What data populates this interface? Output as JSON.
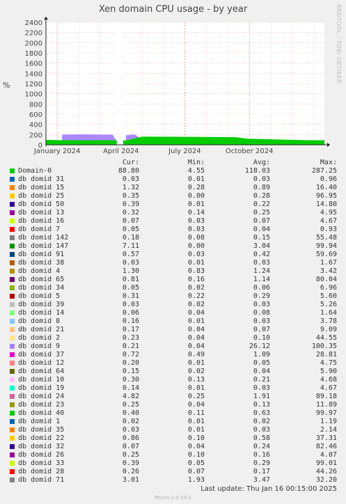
{
  "chart_data": {
    "type": "area",
    "title": "Xen domain CPU usage - by year",
    "ylabel": "%",
    "ylim": [
      0,
      2400
    ],
    "yticks": [
      0,
      200,
      400,
      600,
      800,
      1000,
      1200,
      1400,
      1600,
      1800,
      2000,
      2200,
      2400
    ],
    "xticks": [
      "January 2024",
      "April 2024",
      "July 2024",
      "October 2024"
    ],
    "x_range": [
      "2023-12-16",
      "2025-01-16"
    ],
    "grid": true,
    "series_approx": [
      {
        "name": "Domain-0",
        "color": "#00cc00",
        "points": [
          [
            "2023-12-16",
            95
          ],
          [
            "2024-01-08",
            90
          ],
          [
            "2024-03-25",
            88
          ],
          [
            "2024-04-08",
            85
          ],
          [
            "2024-05-01",
            160
          ],
          [
            "2024-09-10",
            150
          ],
          [
            "2024-09-28",
            120
          ],
          [
            "2024-12-20",
            90
          ],
          [
            "2025-01-16",
            88
          ]
        ]
      },
      {
        "name": "db domid 9",
        "color": "#aa88ff",
        "points": [
          [
            "2024-01-08",
            110
          ],
          [
            "2024-02-01",
            115
          ],
          [
            "2024-03-20",
            110
          ],
          [
            "2024-03-25",
            0
          ]
        ]
      },
      {
        "name": "db domid 9",
        "color": "#aa88ff",
        "points": [
          [
            "2024-04-08",
            100
          ],
          [
            "2024-04-20",
            80
          ],
          [
            "2024-04-27",
            0
          ]
        ]
      }
    ],
    "columns": [
      "Cur:",
      "Min:",
      "Avg:",
      "Max:"
    ],
    "legend": [
      {
        "name": "Domain-0",
        "color": "#00cc00",
        "cur": "88.80",
        "min": "4.55",
        "avg": "118.03",
        "max": "287.25"
      },
      {
        "name": "db domid 31",
        "color": "#0066b3",
        "cur": "0.03",
        "min": "0.01",
        "avg": "0.03",
        "max": "0.96"
      },
      {
        "name": "db domid 15",
        "color": "#ff8000",
        "cur": "1.32",
        "min": "0.28",
        "avg": "0.89",
        "max": "16.40"
      },
      {
        "name": "db domid 25",
        "color": "#ffcc00",
        "cur": "0.35",
        "min": "0.00",
        "avg": "0.28",
        "max": "96.95"
      },
      {
        "name": "db domid 50",
        "color": "#330099",
        "cur": "0.39",
        "min": "0.01",
        "avg": "0.22",
        "max": "14.80"
      },
      {
        "name": "db domid 13",
        "color": "#990099",
        "cur": "0.32",
        "min": "0.14",
        "avg": "0.25",
        "max": "4.95"
      },
      {
        "name": "db domid 16",
        "color": "#ccff00",
        "cur": "0.07",
        "min": "0.03",
        "avg": "0.07",
        "max": "4.67"
      },
      {
        "name": "db domid 7",
        "color": "#ff0000",
        "cur": "0.05",
        "min": "0.03",
        "avg": "0.04",
        "max": "0.93"
      },
      {
        "name": "db domid 142",
        "color": "#808080",
        "cur": "0.18",
        "min": "0.08",
        "avg": "0.15",
        "max": "55.48"
      },
      {
        "name": "db domid 147",
        "color": "#008f00",
        "cur": "7.11",
        "min": "0.00",
        "avg": "3.04",
        "max": "99.94"
      },
      {
        "name": "db domid 91",
        "color": "#00487d",
        "cur": "0.57",
        "min": "0.03",
        "avg": "0.42",
        "max": "59.69"
      },
      {
        "name": "db domid 38",
        "color": "#b35a00",
        "cur": "0.03",
        "min": "0.01",
        "avg": "0.03",
        "max": "1.67"
      },
      {
        "name": "db domid 4",
        "color": "#b38f00",
        "cur": "1.30",
        "min": "0.83",
        "avg": "1.24",
        "max": "3.42"
      },
      {
        "name": "db domid 65",
        "color": "#6b006b",
        "cur": "0.81",
        "min": "0.16",
        "avg": "1.14",
        "max": "80.04"
      },
      {
        "name": "db domid 34",
        "color": "#8fb300",
        "cur": "0.05",
        "min": "0.02",
        "avg": "0.06",
        "max": "6.96"
      },
      {
        "name": "db domid 5",
        "color": "#b30000",
        "cur": "0.31",
        "min": "0.22",
        "avg": "0.29",
        "max": "5.60"
      },
      {
        "name": "db domid 39",
        "color": "#bebebe",
        "cur": "0.03",
        "min": "0.02",
        "avg": "0.03",
        "max": "5.26"
      },
      {
        "name": "db domid 14",
        "color": "#80ff80",
        "cur": "0.06",
        "min": "0.04",
        "avg": "0.08",
        "max": "1.64"
      },
      {
        "name": "db domid 8",
        "color": "#80c9ff",
        "cur": "0.16",
        "min": "0.01",
        "avg": "0.03",
        "max": "3.78"
      },
      {
        "name": "db domid 21",
        "color": "#ffc080",
        "cur": "0.17",
        "min": "0.04",
        "avg": "0.07",
        "max": "9.09"
      },
      {
        "name": "db domid 2",
        "color": "#ffe680",
        "cur": "0.23",
        "min": "0.04",
        "avg": "0.10",
        "max": "44.55"
      },
      {
        "name": "db domid 9",
        "color": "#aa80ff",
        "cur": "0.21",
        "min": "0.04",
        "avg": "26.12",
        "max": "100.35"
      },
      {
        "name": "db domid 37",
        "color": "#ee00cc",
        "cur": "0.72",
        "min": "0.49",
        "avg": "1.09",
        "max": "28.81"
      },
      {
        "name": "db domid 12",
        "color": "#ff8080",
        "cur": "0.20",
        "min": "0.01",
        "avg": "0.05",
        "max": "4.75"
      },
      {
        "name": "db domid 64",
        "color": "#666600",
        "cur": "0.15",
        "min": "0.02",
        "avg": "0.04",
        "max": "5.90"
      },
      {
        "name": "db domid 10",
        "color": "#ffbfff",
        "cur": "0.30",
        "min": "0.13",
        "avg": "0.21",
        "max": "4.68"
      },
      {
        "name": "db domid 19",
        "color": "#00ffcc",
        "cur": "0.14",
        "min": "0.01",
        "avg": "0.03",
        "max": "4.67"
      },
      {
        "name": "db domid 24",
        "color": "#cc6699",
        "cur": "4.82",
        "min": "0.25",
        "avg": "1.91",
        "max": "89.18"
      },
      {
        "name": "db domid 23",
        "color": "#999900",
        "cur": "0.25",
        "min": "0.04",
        "avg": "0.13",
        "max": "11.89"
      },
      {
        "name": "db domid 40",
        "color": "#00cc00",
        "cur": "0.40",
        "min": "0.11",
        "avg": "0.63",
        "max": "99.97"
      },
      {
        "name": "db domid 1",
        "color": "#0066b3",
        "cur": "0.02",
        "min": "0.01",
        "avg": "0.02",
        "max": "1.19"
      },
      {
        "name": "db domid 35",
        "color": "#ff8000",
        "cur": "0.03",
        "min": "0.01",
        "avg": "0.03",
        "max": "2.14"
      },
      {
        "name": "db domid 22",
        "color": "#ffcc00",
        "cur": "0.86",
        "min": "0.10",
        "avg": "0.58",
        "max": "37.31"
      },
      {
        "name": "db domid 32",
        "color": "#330099",
        "cur": "0.07",
        "min": "0.04",
        "avg": "0.24",
        "max": "82.46"
      },
      {
        "name": "db domid 26",
        "color": "#990099",
        "cur": "0.25",
        "min": "0.10",
        "avg": "0.16",
        "max": "4.07"
      },
      {
        "name": "db domid 33",
        "color": "#ccff00",
        "cur": "0.39",
        "min": "0.05",
        "avg": "0.29",
        "max": "99.01"
      },
      {
        "name": "db domid 28",
        "color": "#ff0000",
        "cur": "0.26",
        "min": "0.07",
        "avg": "0.17",
        "max": "44.26"
      },
      {
        "name": "db domid 71",
        "color": "#808080",
        "cur": "3.01",
        "min": "1.93",
        "avg": "3.47",
        "max": "32.20"
      }
    ]
  },
  "footer": {
    "last_update": "Last update:  Thu Jan 16 00:15:00 2025",
    "generator": "Munin 2.0.33-1"
  },
  "watermark": "RRDTOOL / TOBI OETIKER"
}
